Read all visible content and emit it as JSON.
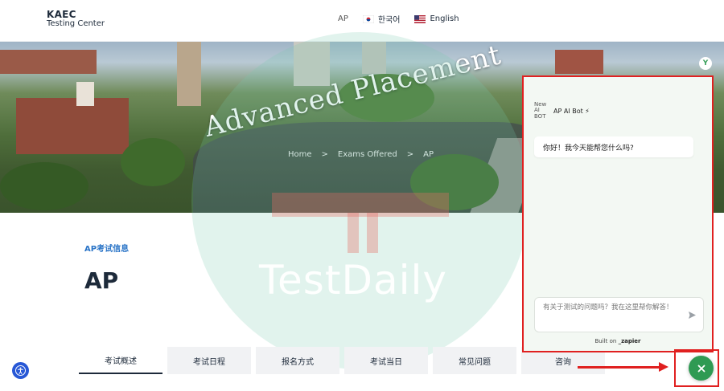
{
  "header": {
    "logo_line1": "KAEC",
    "logo_line2": "Testing Center",
    "nav": {
      "ap": "AP",
      "korean": "한국어",
      "english": "English"
    }
  },
  "banner": {
    "title": "Advanced Placement",
    "breadcrumb": {
      "home": "Home",
      "sep1": ">",
      "exams": "Exams Offered",
      "sep2": ">",
      "current": "AP"
    }
  },
  "watermark": {
    "text": "TestDaily"
  },
  "main": {
    "subtitle": "AP考试信息",
    "title": "AP",
    "tabs": [
      {
        "label": "考试概述"
      },
      {
        "label": "考试日程"
      },
      {
        "label": "报名方式"
      },
      {
        "label": "考试当日"
      },
      {
        "label": "常见问题"
      },
      {
        "label": "咨询"
      }
    ]
  },
  "chat": {
    "bot_image_alt": "New AI BOT",
    "bot_name": "AP AI Bot ⚡",
    "greeting": "你好！我今天能帮您什么吗?",
    "input_placeholder": "有关于测试的问题吗？我在这里帮你解答！",
    "built_on": "Built on",
    "built_brand": "_zapier",
    "badge_letter": "Y"
  },
  "icons": {
    "close": "close-icon",
    "send": "send-icon",
    "accessibility": "accessibility-icon"
  },
  "colors": {
    "accent_blue": "#2a74c7",
    "close_green": "#2f9a53",
    "annotation_red": "#e02020"
  }
}
